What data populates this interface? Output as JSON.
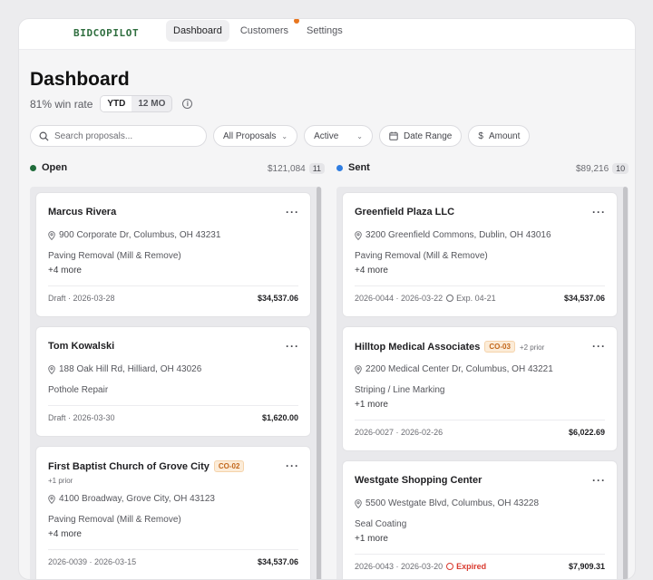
{
  "nav": {
    "logo": "BIDCOPILOT",
    "tabs": [
      "Dashboard",
      "Customers",
      "Settings"
    ]
  },
  "page": {
    "title": "Dashboard",
    "win_rate": "81% win rate",
    "seg": [
      "YTD",
      "12 MO"
    ]
  },
  "filters": {
    "search_placeholder": "Search proposals...",
    "proposals": "All Proposals",
    "status": "Active",
    "date": "Date Range",
    "amount": "Amount"
  },
  "open": {
    "label": "Open",
    "total": "$121,084",
    "count": "11",
    "cards": [
      {
        "name": "Marcus Rivera",
        "address": "900 Corporate Dr, Columbus, OH 43231",
        "service": "Paving Removal (Mill & Remove)",
        "more": "+4 more",
        "footer": "Draft · 2026-03-28",
        "amount": "$34,537.06"
      },
      {
        "name": "Tom Kowalski",
        "address": "188 Oak Hill Rd, Hilliard, OH 43026",
        "service": "Pothole Repair",
        "footer": "Draft · 2026-03-30",
        "amount": "$1,620.00"
      },
      {
        "name": "First Baptist Church of Grove City",
        "badge": "CO-02",
        "prior": "+1 prior",
        "address": "4100 Broadway, Grove City, OH 43123",
        "service": "Paving Removal (Mill & Remove)",
        "more": "+4 more",
        "footer": "2026-0039 · 2026-03-15",
        "amount": "$34,537.06"
      }
    ]
  },
  "sent": {
    "label": "Sent",
    "total": "$89,216",
    "count": "10",
    "cards": [
      {
        "name": "Greenfield Plaza LLC",
        "address": "3200 Greenfield Commons, Dublin, OH 43016",
        "service": "Paving Removal (Mill & Remove)",
        "more": "+4 more",
        "footer": "2026-0044 · 2026-03-22",
        "exp": "Exp. 04-21",
        "amount": "$34,537.06"
      },
      {
        "name": "Hilltop Medical Associates",
        "badge": "CO-03",
        "prior": "+2 prior",
        "address": "2200 Medical Center Dr, Columbus, OH 43221",
        "service": "Striping / Line Marking",
        "more": "+1 more",
        "footer": "2026-0027 · 2026-02-26",
        "amount": "$6,022.69"
      },
      {
        "name": "Westgate Shopping Center",
        "address": "5500 Westgate Blvd, Columbus, OH 43228",
        "service": "Seal Coating",
        "more": "+1 more",
        "footer": "2026-0043 · 2026-03-20",
        "expired": "Expired",
        "amount": "$7,909.31"
      }
    ]
  },
  "colors": {
    "open_dot": "#1f6b3a",
    "sent_dot": "#2f7de1",
    "accent": "#e8761f",
    "expired": "#d93b30"
  }
}
